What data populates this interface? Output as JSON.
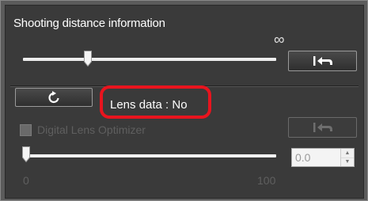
{
  "section": {
    "title": "Shooting distance information",
    "infinity_symbol": "∞"
  },
  "lens": {
    "status_text": "Lens data : No",
    "highlight_color": "#e8141e"
  },
  "dlo": {
    "label": "Digital Lens Optimizer",
    "checked": false,
    "enabled": false
  },
  "dlo_slider": {
    "value": "0.0",
    "min_label": "0",
    "max_label": "100",
    "spin_up_glyph": "▲",
    "spin_down_glyph": "▼"
  },
  "distance_slider": {
    "level_fraction": 0.25
  },
  "icons": {
    "reset_distance": "reset-arrow-icon",
    "refresh": "refresh-icon",
    "reset_dlo": "reset-arrow-icon"
  }
}
